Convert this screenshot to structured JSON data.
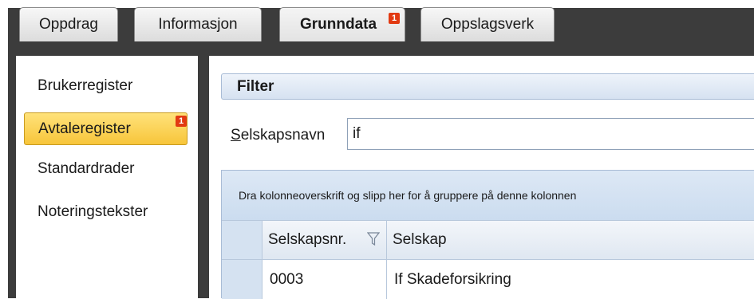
{
  "tabs": [
    {
      "label": "Oppdrag",
      "active": false
    },
    {
      "label": "Informasjon",
      "active": false
    },
    {
      "label": "Grunndata",
      "active": true,
      "badge": "1"
    },
    {
      "label": "Oppslagsverk",
      "active": false
    }
  ],
  "sidebar": {
    "items": [
      {
        "label": "Brukerregister",
        "selected": false
      },
      {
        "label": "Avtaleregister",
        "selected": true,
        "badge": "1"
      },
      {
        "label": "Standardrader",
        "selected": false
      },
      {
        "label": "Noteringstekster",
        "selected": false
      }
    ]
  },
  "filter": {
    "title": "Filter",
    "field_label_accel": "S",
    "field_label_rest": "elskapsnavn",
    "field_value": "if"
  },
  "grid": {
    "group_hint": "Dra kolonneoverskrift og slipp her for å gruppere på denne kolonnen",
    "columns": [
      {
        "label": "Selskapsnr.",
        "filter_icon": "funnel-icon"
      },
      {
        "label": "Selskap"
      }
    ],
    "rows": [
      [
        "0003",
        "If Skadeforsikring"
      ]
    ]
  },
  "colors": {
    "frame": "#3c3c3c",
    "selected_item": "#f7c53a",
    "badge": "#e23a12",
    "header_blue": "#d6e2f1"
  }
}
